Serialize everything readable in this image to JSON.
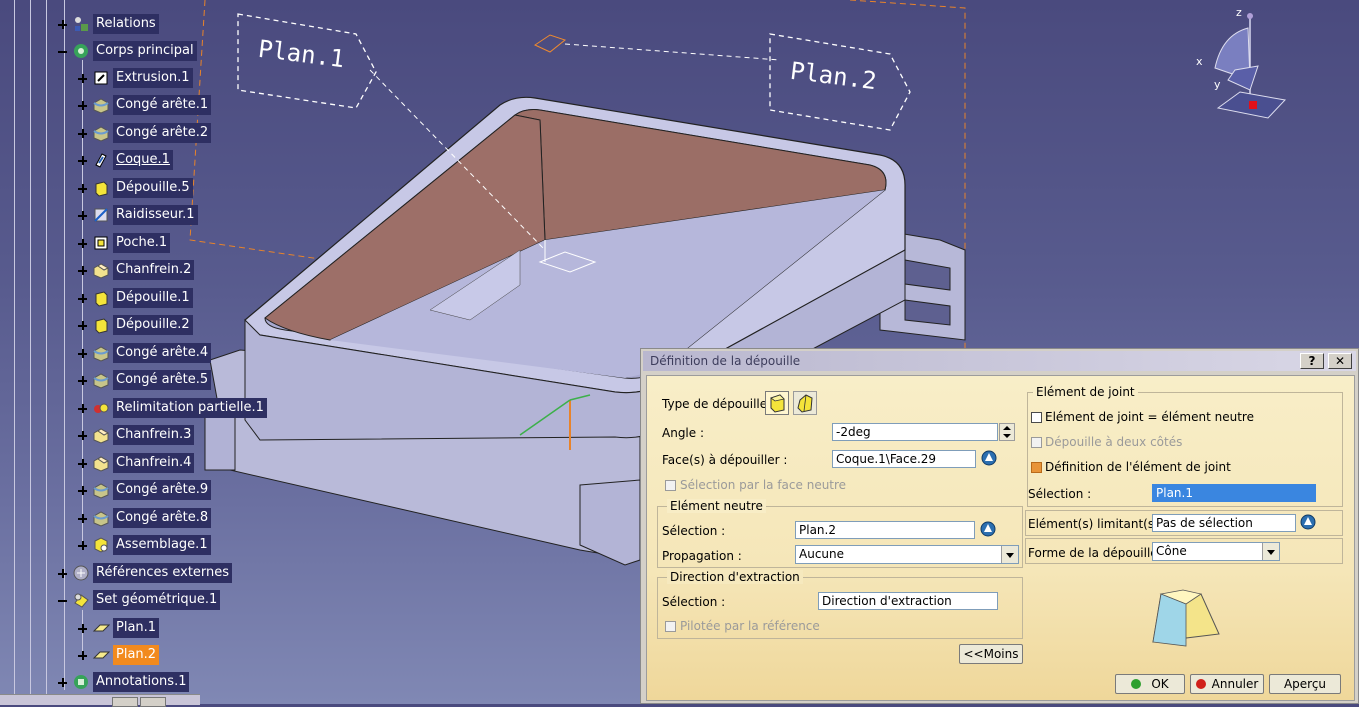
{
  "tree": {
    "items": [
      {
        "label": "Relations",
        "expanded": false
      },
      {
        "label": "Corps principal",
        "expanded": true
      },
      {
        "label": "Extrusion.1"
      },
      {
        "label": "Congé arête.1"
      },
      {
        "label": "Congé arête.2"
      },
      {
        "label": "Coque.1"
      },
      {
        "label": "Dépouille.5"
      },
      {
        "label": "Raidisseur.1"
      },
      {
        "label": "Poche.1"
      },
      {
        "label": "Chanfrein.2"
      },
      {
        "label": "Dépouille.1"
      },
      {
        "label": "Dépouille.2"
      },
      {
        "label": "Congé arête.4"
      },
      {
        "label": "Congé arête.5"
      },
      {
        "label": "Relimitation partielle.1"
      },
      {
        "label": "Chanfrein.3"
      },
      {
        "label": "Chanfrein.4"
      },
      {
        "label": "Congé arête.9"
      },
      {
        "label": "Congé arête.8"
      },
      {
        "label": "Assemblage.1"
      },
      {
        "label": "Références externes",
        "expanded": false
      },
      {
        "label": "Set géométrique.1",
        "expanded": true
      },
      {
        "label": "Plan.1"
      },
      {
        "label": "Plan.2",
        "selected": true
      },
      {
        "label": "Annotations.1",
        "expanded": false
      }
    ]
  },
  "viewport": {
    "plane_labels": [
      "Plan.1",
      "Plan.2"
    ],
    "compass_axes": {
      "x": "x",
      "y": "y",
      "z": "z"
    }
  },
  "dialog": {
    "title": "Définition de la dépouille",
    "help_btn": "?",
    "close_btn": "✕",
    "type_label": "Type de dépouille :",
    "angle_label": "Angle :",
    "angle_value": "-2deg",
    "faces_label": "Face(s) à dépouiller :",
    "faces_value": "Coque.1\\Face.29",
    "select_by_neutral": "Sélection par la face neutre",
    "neutral": {
      "title": "Elément neutre",
      "selection_label": "Sélection :",
      "selection_value": "Plan.2",
      "propagation_label": "Propagation :",
      "propagation_value": "Aucune"
    },
    "pull": {
      "title": "Direction d'extraction",
      "selection_label": "Sélection :",
      "selection_value": "Direction d'extraction",
      "controlled_by_ref": "Pilotée par la référence"
    },
    "less_button": "<<Moins",
    "joint": {
      "title": "Elément de joint",
      "opt1": "Elément de joint = élément neutre",
      "opt2": "Dépouille à deux côtés",
      "opt3": "Définition de l'élément de joint",
      "selection_label": "Sélection :",
      "selection_value": "Plan.1"
    },
    "limiting_label": "Elément(s) limitant(s) :",
    "limiting_value": "Pas de sélection",
    "shape_label": "Forme de la dépouille :",
    "shape_value": "Cône",
    "ok_label": "OK",
    "cancel_label": "Annuler",
    "preview_label": "Aperçu"
  },
  "colors": {
    "background_top": "#4a4a7e",
    "part_face": "#c5c6e6",
    "part_inner": "#9c6e66",
    "tree_label_bg": "#2e2f62",
    "tree_selected": "#f28a1e",
    "dialog_body": "#f5e6b8"
  }
}
